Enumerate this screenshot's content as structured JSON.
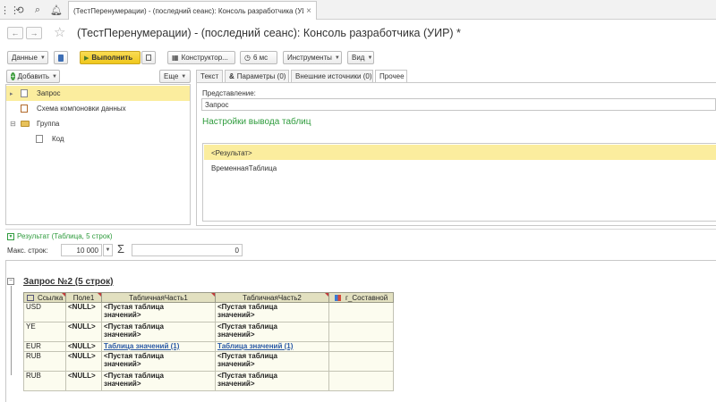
{
  "tab": {
    "title": "(ТестПеренумерации) - (последний сеанс): Консоль разработчика (УИР) *",
    "close": "×"
  },
  "window": {
    "title": "(ТестПеренумерации) - (последний сеанс): Консоль разработчика (УИР) *"
  },
  "toolbar": {
    "data_label": "Данные",
    "run_label": "Выполнить",
    "constructor_label": "Конструктор...",
    "time_label": "6 мс",
    "tools_label": "Инструменты",
    "view_label": "Вид"
  },
  "left": {
    "add_label": "Добавить",
    "more_label": "Еще",
    "tree": [
      {
        "label": "Запрос"
      },
      {
        "label": "Схема компоновки данных"
      },
      {
        "label": "Группа"
      },
      {
        "label": "Код"
      }
    ]
  },
  "right": {
    "tabs": [
      {
        "label": "Текст"
      },
      {
        "label": "Параметры (0)"
      },
      {
        "label": "Внешние источники (0)"
      },
      {
        "label": "Прочее"
      }
    ],
    "presentation_label": "Представление:",
    "presentation_value": "Запрос",
    "section_title": "Настройки вывода таблиц",
    "list": [
      {
        "label": "<Результат>"
      },
      {
        "label": "ВременнаяТаблица"
      }
    ]
  },
  "result": {
    "header": "Результат (Таблица, 5 строк)",
    "max_rows_label": "Макс. строк:",
    "max_rows_value": "10 000",
    "sum_symbol": "Σ",
    "sum_value": "0",
    "query_title": "Запрос №2 (5 строк)",
    "columns": [
      "Ссылка",
      "Поле1",
      "ТабличнаяЧасть1",
      "ТабличнаяЧасть2",
      "г_Составной"
    ],
    "rows": [
      {
        "c0": "USD",
        "c1": "<NULL>",
        "c2a": "<Пустая таблица",
        "c2b": "значений>",
        "c3a": "<Пустая таблица",
        "c3b": "значений>",
        "c4": ""
      },
      {
        "c0": "YE",
        "c1": "<NULL>",
        "c2a": "<Пустая таблица",
        "c2b": "значений>",
        "c3a": "<Пустая таблица",
        "c3b": "значений>",
        "c4": ""
      },
      {
        "c0": "EUR",
        "c1": "<NULL>",
        "c2a": "Таблица значений (1)",
        "c2b": "",
        "c3a": "Таблица значений (1)",
        "c3b": "",
        "c4": ""
      },
      {
        "c0": "RUB",
        "c1": "<NULL>",
        "c2a": "<Пустая таблица",
        "c2b": "значений>",
        "c3a": "<Пустая таблица",
        "c3b": "значений>",
        "c4": ""
      },
      {
        "c0": "RUB",
        "c1": "<NULL>",
        "c2a": "<Пустая таблица",
        "c2b": "значений>",
        "c3a": "<Пустая таблица",
        "c3b": "значений>",
        "c4": ""
      }
    ]
  },
  "colors": {
    "run_button": "#f5d22f",
    "selection": "#fbed9e",
    "section_title": "#2e9b3c",
    "link": "#2a59a5"
  }
}
